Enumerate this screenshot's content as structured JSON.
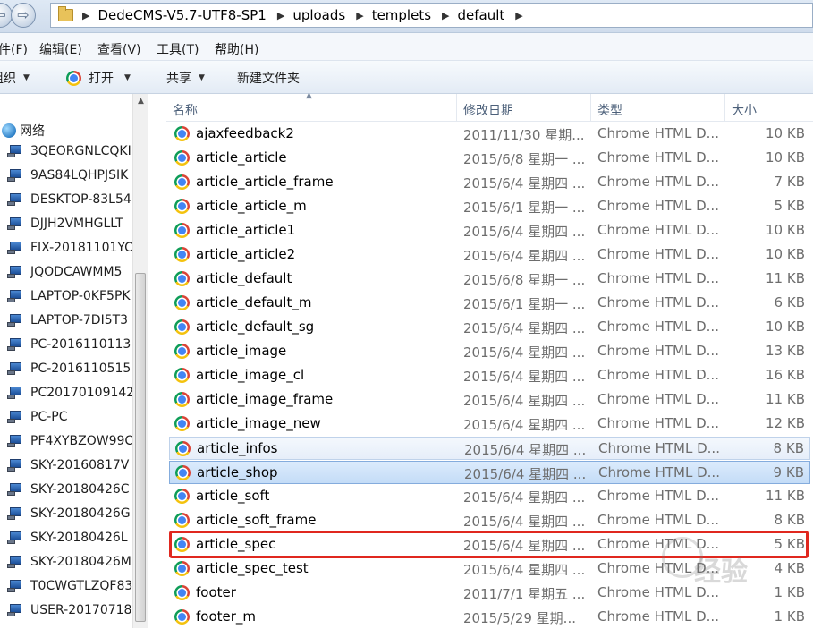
{
  "address": {
    "crumbs": [
      "DedeCMS-V5.7-UTF8-SP1",
      "uploads",
      "templets",
      "default"
    ]
  },
  "menu": {
    "items": [
      "件(F)",
      "编辑(E)",
      "查看(V)",
      "工具(T)",
      "帮助(H)"
    ]
  },
  "toolbar": {
    "organize": "组织",
    "open": "打开",
    "share": "共享",
    "new_folder": "新建文件夹"
  },
  "nav": {
    "network": "网络",
    "computers": [
      "3QEORGNLCQKI",
      "9AS84LQHPJSIK",
      "DESKTOP-83L54",
      "DJJH2VMHGLLT",
      "FIX-20181101YC",
      "JQODCAWMM5",
      "LAPTOP-0KF5PK",
      "LAPTOP-7DI5T3",
      "PC-2016110113",
      "PC-2016110515",
      "PC20170109142",
      "PC-PC",
      "PF4XYBZOW99C",
      "SKY-20160817V",
      "SKY-20180426C",
      "SKY-20180426G",
      "SKY-20180426L",
      "SKY-20180426M",
      "T0CWGTLZQF83",
      "USER-20170718"
    ]
  },
  "columns": {
    "name": "名称",
    "date": "修改日期",
    "type": "类型",
    "size": "大小"
  },
  "files": [
    {
      "name": "ajaxfeedback2",
      "date": "2011/11/30 星期...",
      "type": "Chrome HTML D...",
      "size": "10 KB"
    },
    {
      "name": "article_article",
      "date": "2015/6/8 星期一 ...",
      "type": "Chrome HTML D...",
      "size": "10 KB"
    },
    {
      "name": "article_article_frame",
      "date": "2015/6/4 星期四 ...",
      "type": "Chrome HTML D...",
      "size": "7 KB"
    },
    {
      "name": "article_article_m",
      "date": "2015/6/1 星期一 ...",
      "type": "Chrome HTML D...",
      "size": "5 KB"
    },
    {
      "name": "article_article1",
      "date": "2015/6/4 星期四 ...",
      "type": "Chrome HTML D...",
      "size": "10 KB"
    },
    {
      "name": "article_article2",
      "date": "2015/6/4 星期四 ...",
      "type": "Chrome HTML D...",
      "size": "10 KB"
    },
    {
      "name": "article_default",
      "date": "2015/6/8 星期一 ...",
      "type": "Chrome HTML D...",
      "size": "11 KB"
    },
    {
      "name": "article_default_m",
      "date": "2015/6/1 星期一 ...",
      "type": "Chrome HTML D...",
      "size": "6 KB"
    },
    {
      "name": "article_default_sg",
      "date": "2015/6/4 星期四 ...",
      "type": "Chrome HTML D...",
      "size": "10 KB"
    },
    {
      "name": "article_image",
      "date": "2015/6/4 星期四 ...",
      "type": "Chrome HTML D...",
      "size": "13 KB"
    },
    {
      "name": "article_image_cl",
      "date": "2015/6/4 星期四 ...",
      "type": "Chrome HTML D...",
      "size": "16 KB"
    },
    {
      "name": "article_image_frame",
      "date": "2015/6/4 星期四 ...",
      "type": "Chrome HTML D...",
      "size": "11 KB"
    },
    {
      "name": "article_image_new",
      "date": "2015/6/4 星期四 ...",
      "type": "Chrome HTML D...",
      "size": "12 KB"
    },
    {
      "name": "article_infos",
      "date": "2015/6/4 星期四 ...",
      "type": "Chrome HTML D...",
      "size": "8 KB"
    },
    {
      "name": "article_shop",
      "date": "2015/6/4 星期四 ...",
      "type": "Chrome HTML D...",
      "size": "9 KB"
    },
    {
      "name": "article_soft",
      "date": "2015/6/4 星期四 ...",
      "type": "Chrome HTML D...",
      "size": "11 KB"
    },
    {
      "name": "article_soft_frame",
      "date": "2015/6/4 星期四 ...",
      "type": "Chrome HTML D...",
      "size": "8 KB"
    },
    {
      "name": "article_spec",
      "date": "2015/6/4 星期四 ...",
      "type": "Chrome HTML D...",
      "size": "5 KB"
    },
    {
      "name": "article_spec_test",
      "date": "2015/6/4 星期四 ...",
      "type": "Chrome HTML D...",
      "size": "4 KB"
    },
    {
      "name": "footer",
      "date": "2011/7/1 星期五 ...",
      "type": "Chrome HTML D...",
      "size": "1 KB"
    },
    {
      "name": "footer_m",
      "date": "2015/5/29 星期...",
      "type": "Chrome HTML D...",
      "size": "1 KB"
    }
  ],
  "watermark": "经验",
  "colors": {
    "selection": "#c4dcf7",
    "highlight_box": "#e0281f"
  }
}
